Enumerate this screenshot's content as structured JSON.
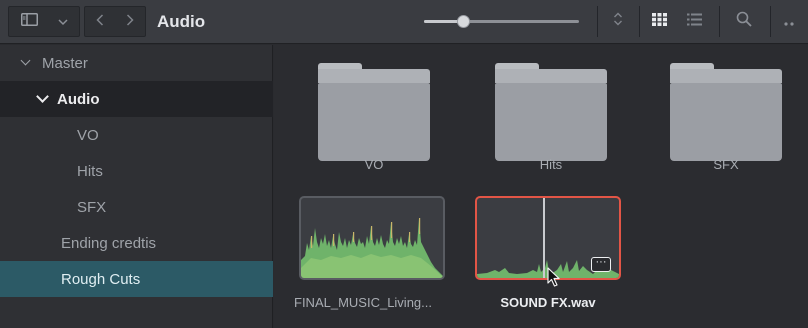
{
  "toolbar": {
    "title": "Audio",
    "icons": [
      "panel-toggle-icon",
      "chevron-down-icon",
      "back-icon",
      "forward-icon",
      "sort-icon",
      "grid-view-icon",
      "list-view-icon",
      "search-icon",
      "more-icon"
    ],
    "zoom_slider_value": 0.25
  },
  "sidebar": {
    "items": [
      {
        "label": "Master",
        "level": 0,
        "expanded": true
      },
      {
        "label": "Audio",
        "level": 1,
        "expanded": true,
        "active": true
      },
      {
        "label": "VO",
        "level": 2
      },
      {
        "label": "Hits",
        "level": 2
      },
      {
        "label": "SFX",
        "level": 2
      },
      {
        "label": "Ending credtis",
        "level": 1
      },
      {
        "label": "Rough Cuts",
        "level": 1,
        "selected": true
      }
    ]
  },
  "content": {
    "folders": [
      {
        "label": "VO"
      },
      {
        "label": "Hits"
      },
      {
        "label": "SFX"
      }
    ],
    "clips": [
      {
        "label": "FINAL_MUSIC_Living...",
        "selected": false
      },
      {
        "label": "SOUND FX.wav",
        "selected": true
      }
    ]
  },
  "colors": {
    "toolbar_bg": "#3a3c41",
    "sidebar_selected": "#2c5a66",
    "clip_selected_border": "#e25546",
    "waveform_green": "#6fb36a"
  }
}
